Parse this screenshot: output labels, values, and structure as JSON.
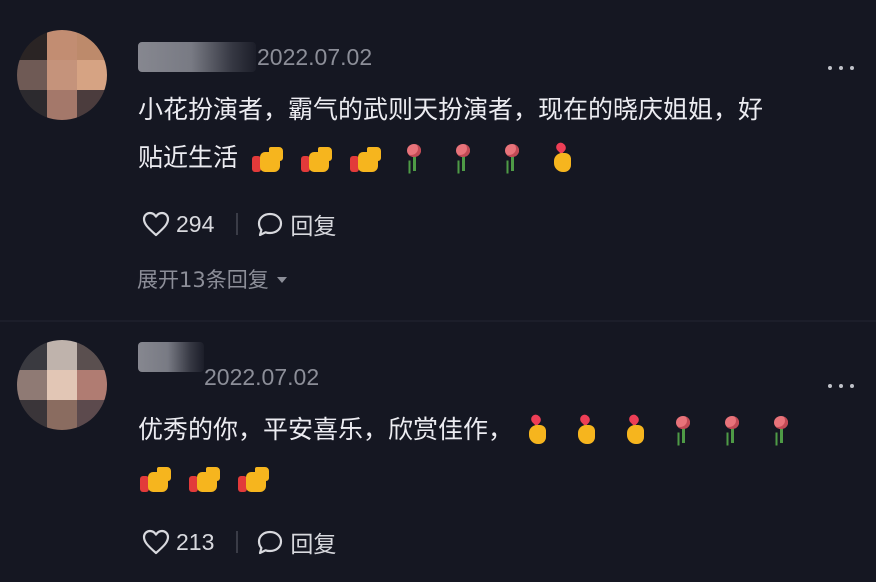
{
  "comments": [
    {
      "date": "2022.07.02",
      "text_lines": [
        "小花扮演者，霸气的武则天扮演者，现在的晓庆姐姐，好",
        "贴近生活"
      ],
      "emoji_line2": [
        "thumbs-up",
        "thumbs-up",
        "thumbs-up",
        "rose",
        "rose",
        "rose",
        "finger-heart"
      ],
      "likes": "294",
      "reply_label": "回复",
      "expand_label": "展开13条回复"
    },
    {
      "date": "2022.07.02",
      "text_lines": [
        "优秀的你，平安喜乐，欣赏佳作，"
      ],
      "emoji_line1": [
        "finger-heart",
        "finger-heart",
        "finger-heart",
        "rose",
        "rose",
        "rose"
      ],
      "emoji_line2": [
        "thumbs-up",
        "thumbs-up",
        "thumbs-up"
      ],
      "likes": "213",
      "reply_label": "回复"
    }
  ],
  "icons": {
    "like": "heart-outline-icon",
    "reply": "speech-bubble-icon",
    "more": "more-dots-icon",
    "expand": "caret-down-icon"
  },
  "colors": {
    "background": "#151722",
    "text": "#ececf1",
    "muted": "#8c8e98"
  }
}
